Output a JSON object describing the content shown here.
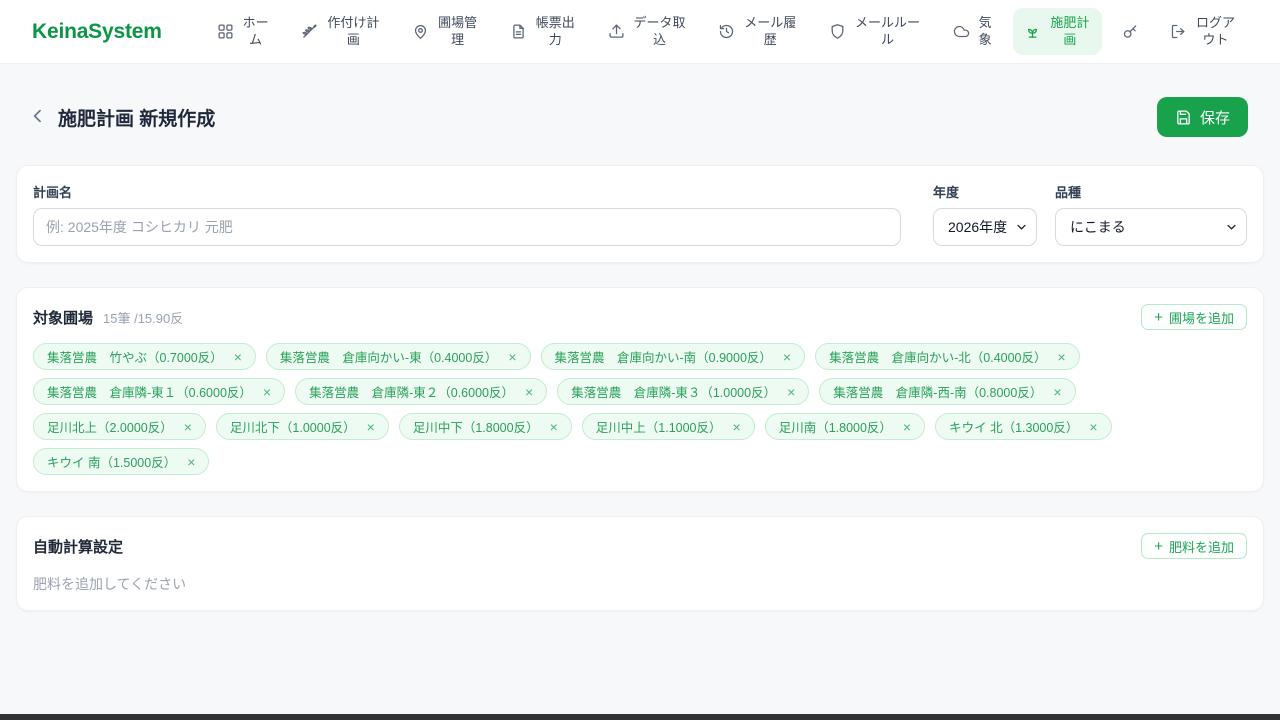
{
  "app": {
    "title": "KeinaSystem"
  },
  "nav": {
    "items": [
      {
        "label": "ホーム",
        "icon": "grid-icon",
        "active": false
      },
      {
        "label": "作付け計画",
        "icon": "wheat-icon",
        "active": false
      },
      {
        "label": "圃場管理",
        "icon": "map-pin-icon",
        "active": false
      },
      {
        "label": "帳票出力",
        "icon": "document-icon",
        "active": false
      },
      {
        "label": "データ取込",
        "icon": "upload-icon",
        "active": false
      },
      {
        "label": "メール履歴",
        "icon": "history-icon",
        "active": false
      },
      {
        "label": "メールルール",
        "icon": "shield-icon",
        "active": false
      },
      {
        "label": "気象",
        "icon": "cloud-icon",
        "active": false
      },
      {
        "label": "施肥計画",
        "icon": "sprout-icon",
        "active": true
      },
      {
        "label": "",
        "icon": "key-icon",
        "active": false
      },
      {
        "label": "ログアウト",
        "icon": "logout-icon",
        "active": false
      }
    ]
  },
  "page": {
    "title": "施肥計画 新規作成",
    "save_button": "保存"
  },
  "form": {
    "plan_name": {
      "label": "計画名",
      "value": "",
      "placeholder": "例: 2025年度 コシヒカリ 元肥"
    },
    "year": {
      "label": "年度",
      "value": "2026年度"
    },
    "variety": {
      "label": "品種",
      "value": "にこまる"
    }
  },
  "fields_section": {
    "title": "対象圃場",
    "count": "15筆 /15.90反",
    "add_button": "圃場を追加",
    "chips": [
      {
        "label": "集落営農　竹やぶ（0.7000反）"
      },
      {
        "label": "集落営農　倉庫向かい-東（0.4000反）"
      },
      {
        "label": "集落営農　倉庫向かい-南（0.9000反）"
      },
      {
        "label": "集落営農　倉庫向かい-北（0.4000反）"
      },
      {
        "label": "集落営農　倉庫隣-東１（0.6000反）"
      },
      {
        "label": "集落営農　倉庫隣-東２（0.6000反）"
      },
      {
        "label": "集落営農　倉庫隣-東３（1.0000反）"
      },
      {
        "label": "集落営農　倉庫隣-西-南（0.8000反）"
      },
      {
        "label": "足川北上（2.0000反）"
      },
      {
        "label": "足川北下（1.0000反）"
      },
      {
        "label": "足川中下（1.8000反）"
      },
      {
        "label": "足川中上（1.1000反）"
      },
      {
        "label": "足川南（1.8000反）"
      },
      {
        "label": "キウイ 北（1.3000反）"
      },
      {
        "label": "キウイ 南（1.5000反）"
      }
    ]
  },
  "auto_calc_section": {
    "title": "自動計算設定",
    "add_button": "肥料を追加",
    "empty_text": "肥料を追加してください"
  },
  "colors": {
    "logo_green": "#0c9447",
    "brand_green": "#17a24b",
    "active_nav_bg": "#e9f8ef",
    "chip_bg": "#eefbf2",
    "chip_border": "#c3ecd2",
    "chip_text": "#2aa05b",
    "page_bg": "#f7f8fa",
    "bottom_bar": "#323232"
  }
}
